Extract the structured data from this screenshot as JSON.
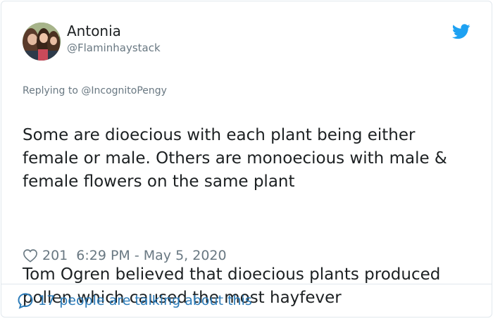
{
  "author": {
    "display_name": "Antonia",
    "handle": "@Flaminhaystack"
  },
  "reply_context": "Replying to @IncognitoPengy",
  "tweet": {
    "paragraph_1": "Some are dioecious with each plant being either female or male. Others are monoecious with male & female flowers on the same plant",
    "paragraph_2": "Tom Ogren believed that dioecious plants produced pollen which caused the most hayfever"
  },
  "meta": {
    "like_count": "201",
    "timestamp": "6:29 PM - May 5, 2020"
  },
  "footer": {
    "talking_label": "17 people are talking about this"
  },
  "colors": {
    "twitter_blue": "#1da1f2",
    "link_blue": "#2b7bb9",
    "secondary_text": "#697882",
    "border": "#e1e8ed"
  },
  "icons": {
    "brand": "twitter-bird-icon",
    "like": "heart-outline-icon",
    "talk": "speech-bubble-icon"
  }
}
